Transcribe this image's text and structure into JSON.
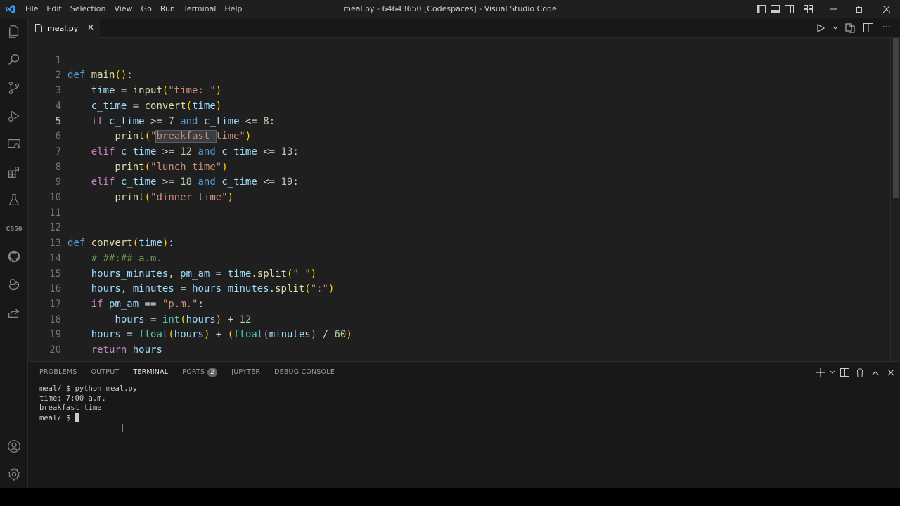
{
  "titlebar": {
    "menu": [
      "File",
      "Edit",
      "Selection",
      "View",
      "Go",
      "Run",
      "Terminal",
      "Help"
    ],
    "title": "meal.py - 64643650 [Codespaces] - Visual Studio Code"
  },
  "activitybar": {
    "icons": [
      "explorer-icon",
      "search-icon",
      "source-control-icon",
      "run-debug-icon",
      "remote-explorer-icon",
      "extensions-icon",
      "testing-icon",
      "cs50-icon",
      "github-icon",
      "ducky-icon",
      "live-share-icon",
      "account-icon",
      "settings-gear-icon"
    ],
    "cs50_label": "CS50"
  },
  "tab": {
    "label": "meal.py",
    "close": "✕"
  },
  "code": {
    "lines": [
      "def main():",
      "    time = input(\"time: \")",
      "    c_time = convert(time)",
      "    if c_time >= 7 and c_time <= 8:",
      "        print(\"breakfast time\")",
      "    elif c_time >= 12 and c_time <= 13:",
      "        print(\"lunch time\")",
      "    elif c_time >= 18 and c_time <= 19:",
      "        print(\"dinner time\")",
      "",
      "",
      "def convert(time):",
      "    # ##:## a.m.",
      "    hours_minutes, pm_am = time.split(\" \")",
      "    hours, minutes = hours_minutes.split(\":\")",
      "    if pm_am == \"p.m.\":",
      "        hours = int(hours) + 12",
      "    hours = float(hours) + (float(minutes) / 60)",
      "    return hours",
      "",
      ""
    ],
    "active_line": 5
  },
  "panel": {
    "tabs": [
      "PROBLEMS",
      "OUTPUT",
      "TERMINAL",
      "PORTS",
      "JUPYTER",
      "DEBUG CONSOLE"
    ],
    "active_tab": "TERMINAL",
    "ports_badge": "2",
    "terminal_lines": [
      "meal/ $ python meal.py",
      "time: 7:00 a.m.",
      "breakfast time",
      "meal/ $ "
    ]
  },
  "colors": {
    "accent": "#0078d4",
    "editor_bg": "#1f1f1f",
    "sidebar_bg": "#181818"
  }
}
